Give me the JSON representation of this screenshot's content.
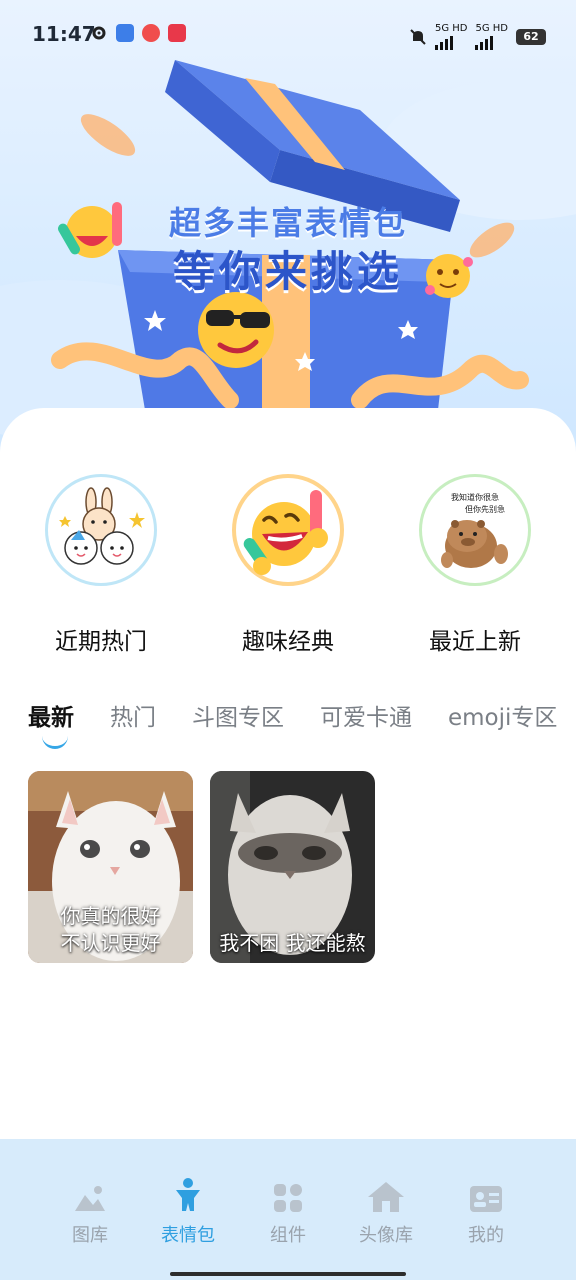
{
  "status_bar": {
    "time": "11:47",
    "network_1": "5G HD",
    "network_2": "5G HD",
    "battery": "62"
  },
  "banner": {
    "line1": "超多丰富表情包",
    "line2": "等你来挑选"
  },
  "categories": [
    {
      "label": "近期热门",
      "icon": "bunny-cartoon-icon"
    },
    {
      "label": "趣味经典",
      "icon": "laughing-emoji-icon"
    },
    {
      "label": "最近上新",
      "icon": "capybara-icon",
      "caption_line1": "我知道你很急",
      "caption_line2": "但你先别急"
    }
  ],
  "tabs": [
    "最新",
    "热门",
    "斗图专区",
    "可爱卡通",
    "emoji专区"
  ],
  "active_tab": "最新",
  "stickers": [
    {
      "caption_line1": "你真的很好",
      "caption_line2": "不认识更好"
    },
    {
      "caption_line1": "我不困 我还能熬",
      "caption_line2": ""
    }
  ],
  "bottom_nav": [
    {
      "label": "图库",
      "icon": "gallery-icon",
      "active": false
    },
    {
      "label": "表情包",
      "icon": "person-icon",
      "active": true
    },
    {
      "label": "组件",
      "icon": "widgets-icon",
      "active": false
    },
    {
      "label": "头像库",
      "icon": "house-icon",
      "active": false
    },
    {
      "label": "我的",
      "icon": "id-card-icon",
      "active": false
    }
  ],
  "colors": {
    "accent": "#2f9fe0",
    "banner_bg": "#d9ecff",
    "nav_bg": "#d7ebfb",
    "inactive": "#9aa3ad"
  }
}
